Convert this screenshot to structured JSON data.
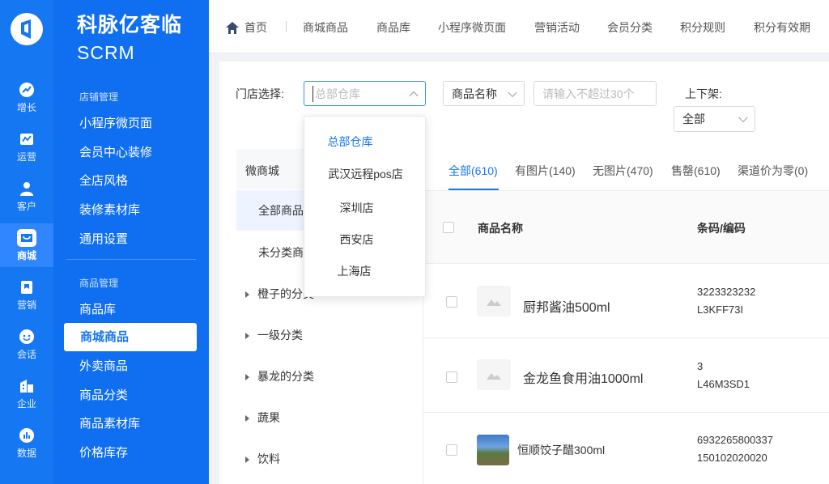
{
  "brand": {
    "line1": "科脉亿客临",
    "line2": "SCRM"
  },
  "rail": [
    {
      "label": "增长",
      "icon": "growth-icon"
    },
    {
      "label": "运营",
      "icon": "operation-icon"
    },
    {
      "label": "客户",
      "icon": "customer-icon"
    },
    {
      "label": "商城",
      "icon": "mall-icon",
      "active": true
    },
    {
      "label": "营销",
      "icon": "marketing-icon"
    },
    {
      "label": "会话",
      "icon": "chat-icon"
    },
    {
      "label": "企业",
      "icon": "enterprise-icon"
    },
    {
      "label": "数据",
      "icon": "data-icon"
    }
  ],
  "menu": {
    "group1": "店铺管理",
    "group1_items": [
      "小程序微页面",
      "会员中心装修",
      "全店风格",
      "装修素材库",
      "通用设置"
    ],
    "group2": "商品管理",
    "group2_items": [
      "商品库",
      "商城商品",
      "外卖商品",
      "商品分类",
      "商品素材库",
      "价格库存"
    ]
  },
  "topbar": {
    "home": "首页",
    "tabs": [
      "商城商品",
      "商品库",
      "小程序微页面",
      "营销活动",
      "会员分类",
      "积分规则",
      "积分有效期"
    ]
  },
  "filters": {
    "store_label": "门店选择:",
    "store_placeholder": "总部仓库",
    "field_select": "商品名称",
    "field_placeholder": "请输入不超过30个",
    "shelf_label": "上下架:",
    "shelf_value": "全部"
  },
  "dropdown": {
    "options": [
      "总部仓库",
      "武汉远程pos店",
      "深圳店",
      "西安店",
      "上海店"
    ],
    "selected": "总部仓库"
  },
  "categories": {
    "title": "微商城",
    "items": [
      "全部商品",
      "未分类商品",
      "橙子的分类",
      "一级分类",
      "暴龙的分类",
      "蔬果",
      "饮料"
    ]
  },
  "filter_tabs": [
    "全部(610)",
    "有图片(140)",
    "无图片(470)",
    "售罄(610)",
    "渠道价为零(0)"
  ],
  "table": {
    "col_name": "商品名称",
    "col_code": "条码/编码",
    "rows": [
      {
        "name": "厨邦酱油500ml",
        "barcode": "3223323232",
        "code": "L3KFF73I"
      },
      {
        "name": "金龙鱼食用油1000ml",
        "barcode": "3",
        "code": "L46M3SD1"
      },
      {
        "name": "恒顺饺子醋300ml",
        "barcode": "6932265800337",
        "code": "150102020020"
      }
    ]
  },
  "colors": {
    "accent": "#1677f2",
    "menu_bg": "#0f6ff0",
    "rail_bg": "#1677f2"
  }
}
